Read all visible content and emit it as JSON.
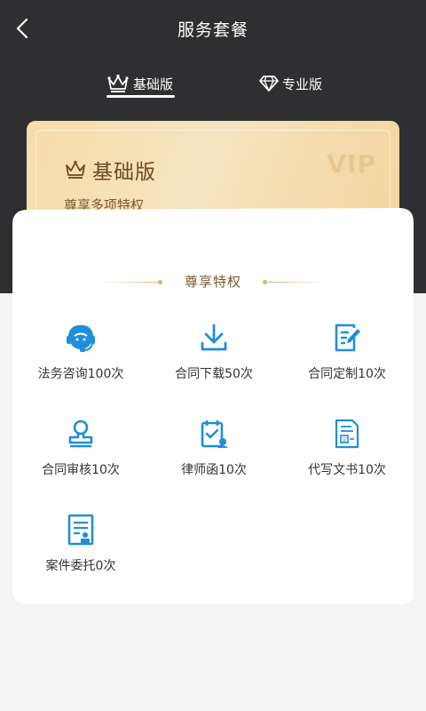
{
  "header": {
    "title": "服务套餐",
    "back_icon": "chevron-left-icon"
  },
  "tabs": [
    {
      "label": "基础版",
      "icon": "crown-icon",
      "active": true
    },
    {
      "label": "专业版",
      "icon": "diamond-icon",
      "active": false
    }
  ],
  "card": {
    "title": "基础版",
    "subtitle": "尊享多项特权",
    "watermark": "VIP",
    "icon": "crown-icon"
  },
  "section": {
    "title": "尊享特权"
  },
  "features": [
    {
      "label": "法务咨询100次",
      "icon": "headset-icon"
    },
    {
      "label": "合同下载50次",
      "icon": "download-icon"
    },
    {
      "label": "合同定制10次",
      "icon": "edit-document-icon"
    },
    {
      "label": "合同审核10次",
      "icon": "stamp-icon"
    },
    {
      "label": "律师函10次",
      "icon": "lawyer-letter-icon"
    },
    {
      "label": "代写文书10次",
      "icon": "document-icon"
    },
    {
      "label": "案件委托0次",
      "icon": "case-entrust-icon"
    }
  ],
  "colors": {
    "dark_bg": "#2f2f31",
    "gold_text": "#7a5a32",
    "icon_blue": "#1e8fd8",
    "page_bg": "#f5f5f6"
  }
}
